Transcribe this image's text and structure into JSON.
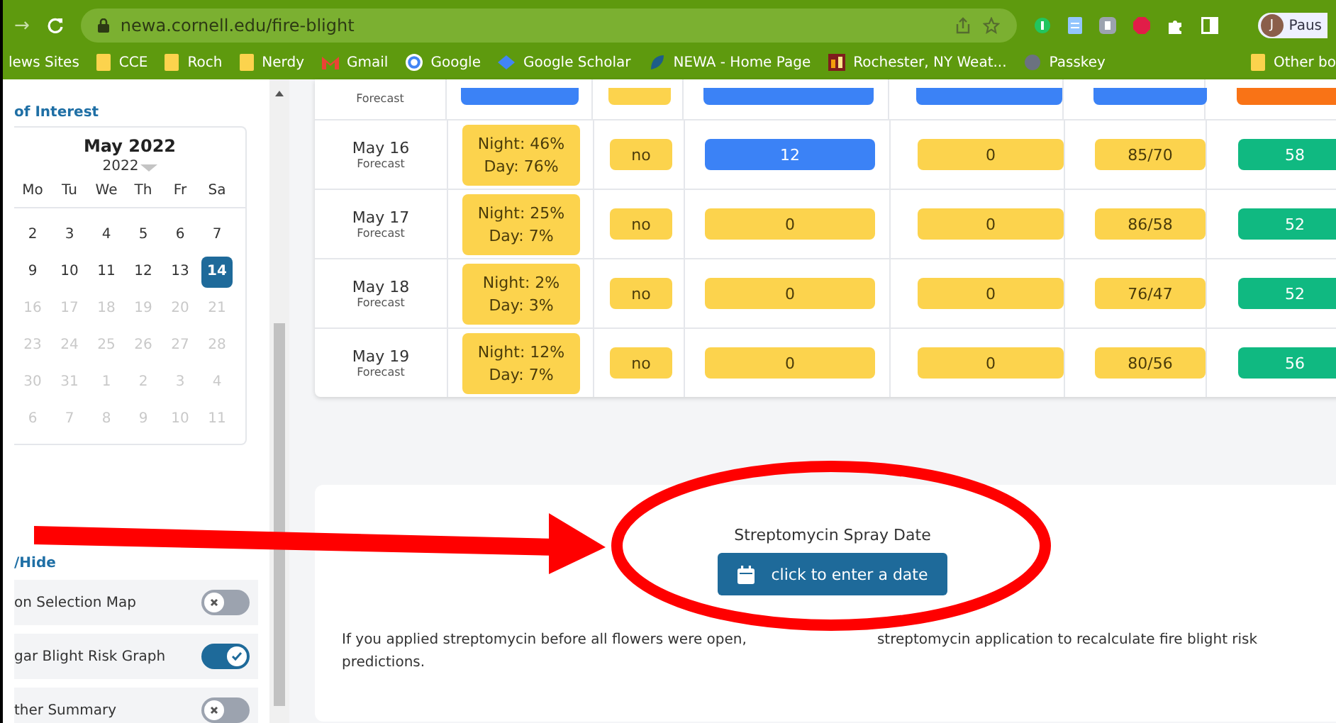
{
  "browser": {
    "forward": "→",
    "url": "newa.cornell.edu/fire-blight",
    "profile_initial": "J",
    "profile_label": "Paus",
    "bookmarks": [
      {
        "label": "lews Sites",
        "kind": "none"
      },
      {
        "label": "CCE",
        "kind": "folder"
      },
      {
        "label": "Roch",
        "kind": "folder"
      },
      {
        "label": "Nerdy",
        "kind": "folder"
      },
      {
        "label": "Gmail",
        "kind": "mail"
      },
      {
        "label": "Google",
        "kind": "globe"
      },
      {
        "label": "Google Scholar",
        "kind": "cap"
      },
      {
        "label": "NEWA - Home Page",
        "kind": "leaf"
      },
      {
        "label": "Rochester, NY Weat...",
        "kind": "site"
      },
      {
        "label": "Passkey",
        "kind": "globe-grey"
      }
    ],
    "other_bookmarks": "Other bo"
  },
  "sidebar": {
    "section_title": "of Interest",
    "calendar": {
      "month": "May 2022",
      "year": "2022",
      "weekdays": [
        "Mo",
        "Tu",
        "We",
        "Th",
        "Fr",
        "Sa"
      ],
      "weeks": [
        [
          {
            "day": "2",
            "disabled": false,
            "selected": false
          },
          {
            "day": "3",
            "disabled": false,
            "selected": false
          },
          {
            "day": "4",
            "disabled": false,
            "selected": false
          },
          {
            "day": "5",
            "disabled": false,
            "selected": false
          },
          {
            "day": "6",
            "disabled": false,
            "selected": false
          },
          {
            "day": "7",
            "disabled": false,
            "selected": false
          }
        ],
        [
          {
            "day": "9",
            "disabled": false,
            "selected": false
          },
          {
            "day": "10",
            "disabled": false,
            "selected": false
          },
          {
            "day": "11",
            "disabled": false,
            "selected": false
          },
          {
            "day": "12",
            "disabled": false,
            "selected": false
          },
          {
            "day": "13",
            "disabled": false,
            "selected": false
          },
          {
            "day": "14",
            "disabled": false,
            "selected": true
          }
        ],
        [
          {
            "day": "16",
            "disabled": true,
            "selected": false
          },
          {
            "day": "17",
            "disabled": true,
            "selected": false
          },
          {
            "day": "18",
            "disabled": true,
            "selected": false
          },
          {
            "day": "19",
            "disabled": true,
            "selected": false
          },
          {
            "day": "20",
            "disabled": true,
            "selected": false
          },
          {
            "day": "21",
            "disabled": true,
            "selected": false
          }
        ],
        [
          {
            "day": "23",
            "disabled": true,
            "selected": false
          },
          {
            "day": "24",
            "disabled": true,
            "selected": false
          },
          {
            "day": "25",
            "disabled": true,
            "selected": false
          },
          {
            "day": "26",
            "disabled": true,
            "selected": false
          },
          {
            "day": "27",
            "disabled": true,
            "selected": false
          },
          {
            "day": "28",
            "disabled": true,
            "selected": false
          }
        ],
        [
          {
            "day": "30",
            "disabled": true,
            "selected": false
          },
          {
            "day": "31",
            "disabled": true,
            "selected": false
          },
          {
            "day": "1",
            "disabled": true,
            "selected": false
          },
          {
            "day": "2",
            "disabled": true,
            "selected": false
          },
          {
            "day": "3",
            "disabled": true,
            "selected": false
          },
          {
            "day": "4",
            "disabled": true,
            "selected": false
          }
        ],
        [
          {
            "day": "6",
            "disabled": true,
            "selected": false
          },
          {
            "day": "7",
            "disabled": true,
            "selected": false
          },
          {
            "day": "8",
            "disabled": true,
            "selected": false
          },
          {
            "day": "9",
            "disabled": true,
            "selected": false
          },
          {
            "day": "10",
            "disabled": true,
            "selected": false
          },
          {
            "day": "11",
            "disabled": true,
            "selected": false
          }
        ]
      ]
    },
    "toggles_title": "/Hide",
    "toggles": [
      {
        "label": "on Selection Map",
        "on": false
      },
      {
        "label": "gar Blight Risk Graph",
        "on": true
      },
      {
        "label": "ther Summary",
        "on": false
      }
    ]
  },
  "table": {
    "rows": [
      {
        "date": "",
        "note": "Forecast",
        "cells": [
          {
            "color": "#3b82f6"
          },
          {
            "color": "#fcd34d"
          },
          {
            "color": "#3b82f6"
          },
          {
            "color": "#3b82f6"
          },
          {
            "color": "#3b82f6"
          },
          {
            "color": "#f97316"
          }
        ]
      },
      {
        "date": "May 16",
        "note": "Forecast",
        "cells": [
          {
            "lines": [
              "Night: 46%",
              "Day: 76%"
            ],
            "color": "#fcd34d"
          },
          {
            "lines": [
              "no"
            ],
            "color": "#fcd34d"
          },
          {
            "lines": [
              "12"
            ],
            "color": "#3b82f6"
          },
          {
            "lines": [
              "0"
            ],
            "color": "#fcd34d"
          },
          {
            "lines": [
              "85/70"
            ],
            "color": "#fcd34d"
          },
          {
            "lines": [
              "58"
            ],
            "color": "#10b981"
          }
        ]
      },
      {
        "date": "May 17",
        "note": "Forecast",
        "cells": [
          {
            "lines": [
              "Night: 25%",
              "Day: 7%"
            ],
            "color": "#fcd34d"
          },
          {
            "lines": [
              "no"
            ],
            "color": "#fcd34d"
          },
          {
            "lines": [
              "0"
            ],
            "color": "#fcd34d"
          },
          {
            "lines": [
              "0"
            ],
            "color": "#fcd34d"
          },
          {
            "lines": [
              "86/58"
            ],
            "color": "#fcd34d"
          },
          {
            "lines": [
              "52"
            ],
            "color": "#10b981"
          }
        ]
      },
      {
        "date": "May 18",
        "note": "Forecast",
        "cells": [
          {
            "lines": [
              "Night: 2%",
              "Day: 3%"
            ],
            "color": "#fcd34d"
          },
          {
            "lines": [
              "no"
            ],
            "color": "#fcd34d"
          },
          {
            "lines": [
              "0"
            ],
            "color": "#fcd34d"
          },
          {
            "lines": [
              "0"
            ],
            "color": "#fcd34d"
          },
          {
            "lines": [
              "76/47"
            ],
            "color": "#fcd34d"
          },
          {
            "lines": [
              "52"
            ],
            "color": "#10b981"
          }
        ]
      },
      {
        "date": "May 19",
        "note": "Forecast",
        "cells": [
          {
            "lines": [
              "Night: 12%",
              "Day: 7%"
            ],
            "color": "#fcd34d"
          },
          {
            "lines": [
              "no"
            ],
            "color": "#fcd34d"
          },
          {
            "lines": [
              "0"
            ],
            "color": "#fcd34d"
          },
          {
            "lines": [
              "0"
            ],
            "color": "#fcd34d"
          },
          {
            "lines": [
              "80/56"
            ],
            "color": "#fcd34d"
          },
          {
            "lines": [
              "56"
            ],
            "color": "#10b981"
          }
        ]
      }
    ]
  },
  "spray": {
    "title": "Streptomycin Spray Date",
    "button": "click to enter a date",
    "note_start": "If you applied streptomycin before all flowers were open,",
    "note_end": "streptomycin application to recalculate fire blight risk",
    "note_last": "predictions."
  }
}
